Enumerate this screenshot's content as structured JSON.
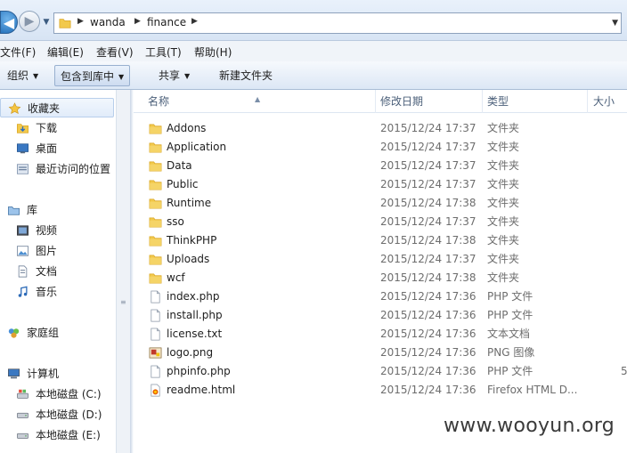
{
  "address": {
    "crumbs": [
      "wanda",
      "finance"
    ]
  },
  "menu": [
    "文件(F)",
    "编辑(E)",
    "查看(V)",
    "工具(T)",
    "帮助(H)"
  ],
  "toolbar": {
    "organize": "组织",
    "include_library": "包含到库中",
    "share": "共享",
    "new_folder": "新建文件夹"
  },
  "nav": {
    "favorites": "收藏夹",
    "downloads": "下载",
    "desktop": "桌面",
    "recent": "最近访问的位置",
    "libraries": "库",
    "videos": "视频",
    "pictures": "图片",
    "documents": "文档",
    "music": "音乐",
    "homegroup": "家庭组",
    "computer": "计算机",
    "disk_c": "本地磁盘 (C:)",
    "disk_d": "本地磁盘 (D:)",
    "disk_e": "本地磁盘 (E:)"
  },
  "columns": {
    "name": "名称",
    "date": "修改日期",
    "type": "类型",
    "size": "大小"
  },
  "files": [
    {
      "name": "Addons",
      "date": "2015/12/24 17:37",
      "type": "文件夹",
      "size": "",
      "kind": "folder"
    },
    {
      "name": "Application",
      "date": "2015/12/24 17:37",
      "type": "文件夹",
      "size": "",
      "kind": "folder"
    },
    {
      "name": "Data",
      "date": "2015/12/24 17:37",
      "type": "文件夹",
      "size": "",
      "kind": "folder"
    },
    {
      "name": "Public",
      "date": "2015/12/24 17:37",
      "type": "文件夹",
      "size": "",
      "kind": "folder"
    },
    {
      "name": "Runtime",
      "date": "2015/12/24 17:38",
      "type": "文件夹",
      "size": "",
      "kind": "folder"
    },
    {
      "name": "sso",
      "date": "2015/12/24 17:37",
      "type": "文件夹",
      "size": "",
      "kind": "folder"
    },
    {
      "name": "ThinkPHP",
      "date": "2015/12/24 17:38",
      "type": "文件夹",
      "size": "",
      "kind": "folder"
    },
    {
      "name": "Uploads",
      "date": "2015/12/24 17:37",
      "type": "文件夹",
      "size": "",
      "kind": "folder"
    },
    {
      "name": "wcf",
      "date": "2015/12/24 17:38",
      "type": "文件夹",
      "size": "",
      "kind": "folder"
    },
    {
      "name": "index.php",
      "date": "2015/12/24 17:36",
      "type": "PHP 文件",
      "size": "",
      "kind": "file"
    },
    {
      "name": "install.php",
      "date": "2015/12/24 17:36",
      "type": "PHP 文件",
      "size": "",
      "kind": "file"
    },
    {
      "name": "license.txt",
      "date": "2015/12/24 17:36",
      "type": "文本文档",
      "size": "",
      "kind": "file"
    },
    {
      "name": "logo.png",
      "date": "2015/12/24 17:36",
      "type": "PNG 图像",
      "size": "",
      "kind": "image"
    },
    {
      "name": "phpinfo.php",
      "date": "2015/12/24 17:36",
      "type": "PHP 文件",
      "size": "5",
      "kind": "file"
    },
    {
      "name": "readme.html",
      "date": "2015/12/24 17:36",
      "type": "Firefox HTML D...",
      "size": "",
      "kind": "html"
    }
  ],
  "watermark": "www.wooyun.org",
  "colors": {
    "folder": "#f2c94c",
    "folder_dark": "#d9a521",
    "selection": "#e1ecfa"
  }
}
